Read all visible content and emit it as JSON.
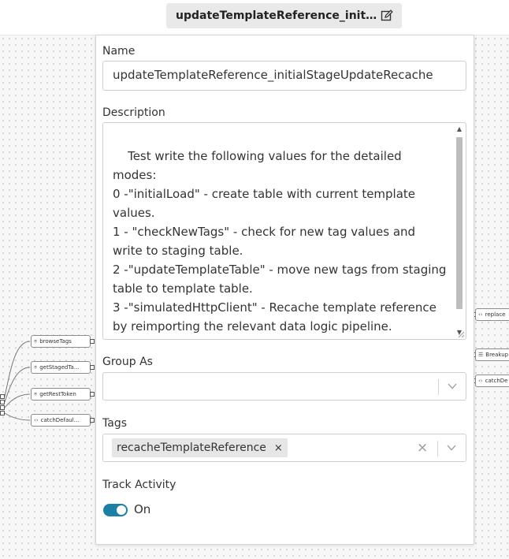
{
  "header": {
    "title": "updateTemplateReference_initialStageUpdateRecache"
  },
  "panel": {
    "name_label": "Name",
    "name_value": "updateTemplateReference_initialStageUpdateRecache",
    "description_label": "Description",
    "description_value": "Test write the following values for the detailed modes:\n0 -\"initialLoad\" - create table with current template values.\n1 - \"checkNewTags\" - check for new tag values and write to staging table.\n2 -\"updateTemplateTable\" - move new tags from staging table to template table.\n3 -\"simulatedHttpClient\" - Recache template reference by reimporting the relevant data logic pipeline.",
    "group_label": "Group As",
    "group_value": "",
    "tags_label": "Tags",
    "tags": [
      "recacheTemplateReference"
    ],
    "tag_remove_glyph": "×",
    "clear_glyph": "×",
    "track_label": "Track Activity",
    "track_state": "On",
    "track_on": true,
    "accent_color": "#1a80a7"
  },
  "canvas": {
    "left_nodes": [
      {
        "label": "browseTags",
        "icon": "⍟"
      },
      {
        "label": "getStagedTa…",
        "icon": "⍟"
      },
      {
        "label": "getRestToken",
        "icon": "⍟"
      },
      {
        "label": "catchDefaul…",
        "icon": "‹›"
      }
    ],
    "right_nodes": [
      {
        "label": "replace",
        "icon": "‹›"
      },
      {
        "label": "Breakup",
        "icon": "☰"
      },
      {
        "label": "catchDe",
        "icon": "‹›"
      }
    ]
  }
}
